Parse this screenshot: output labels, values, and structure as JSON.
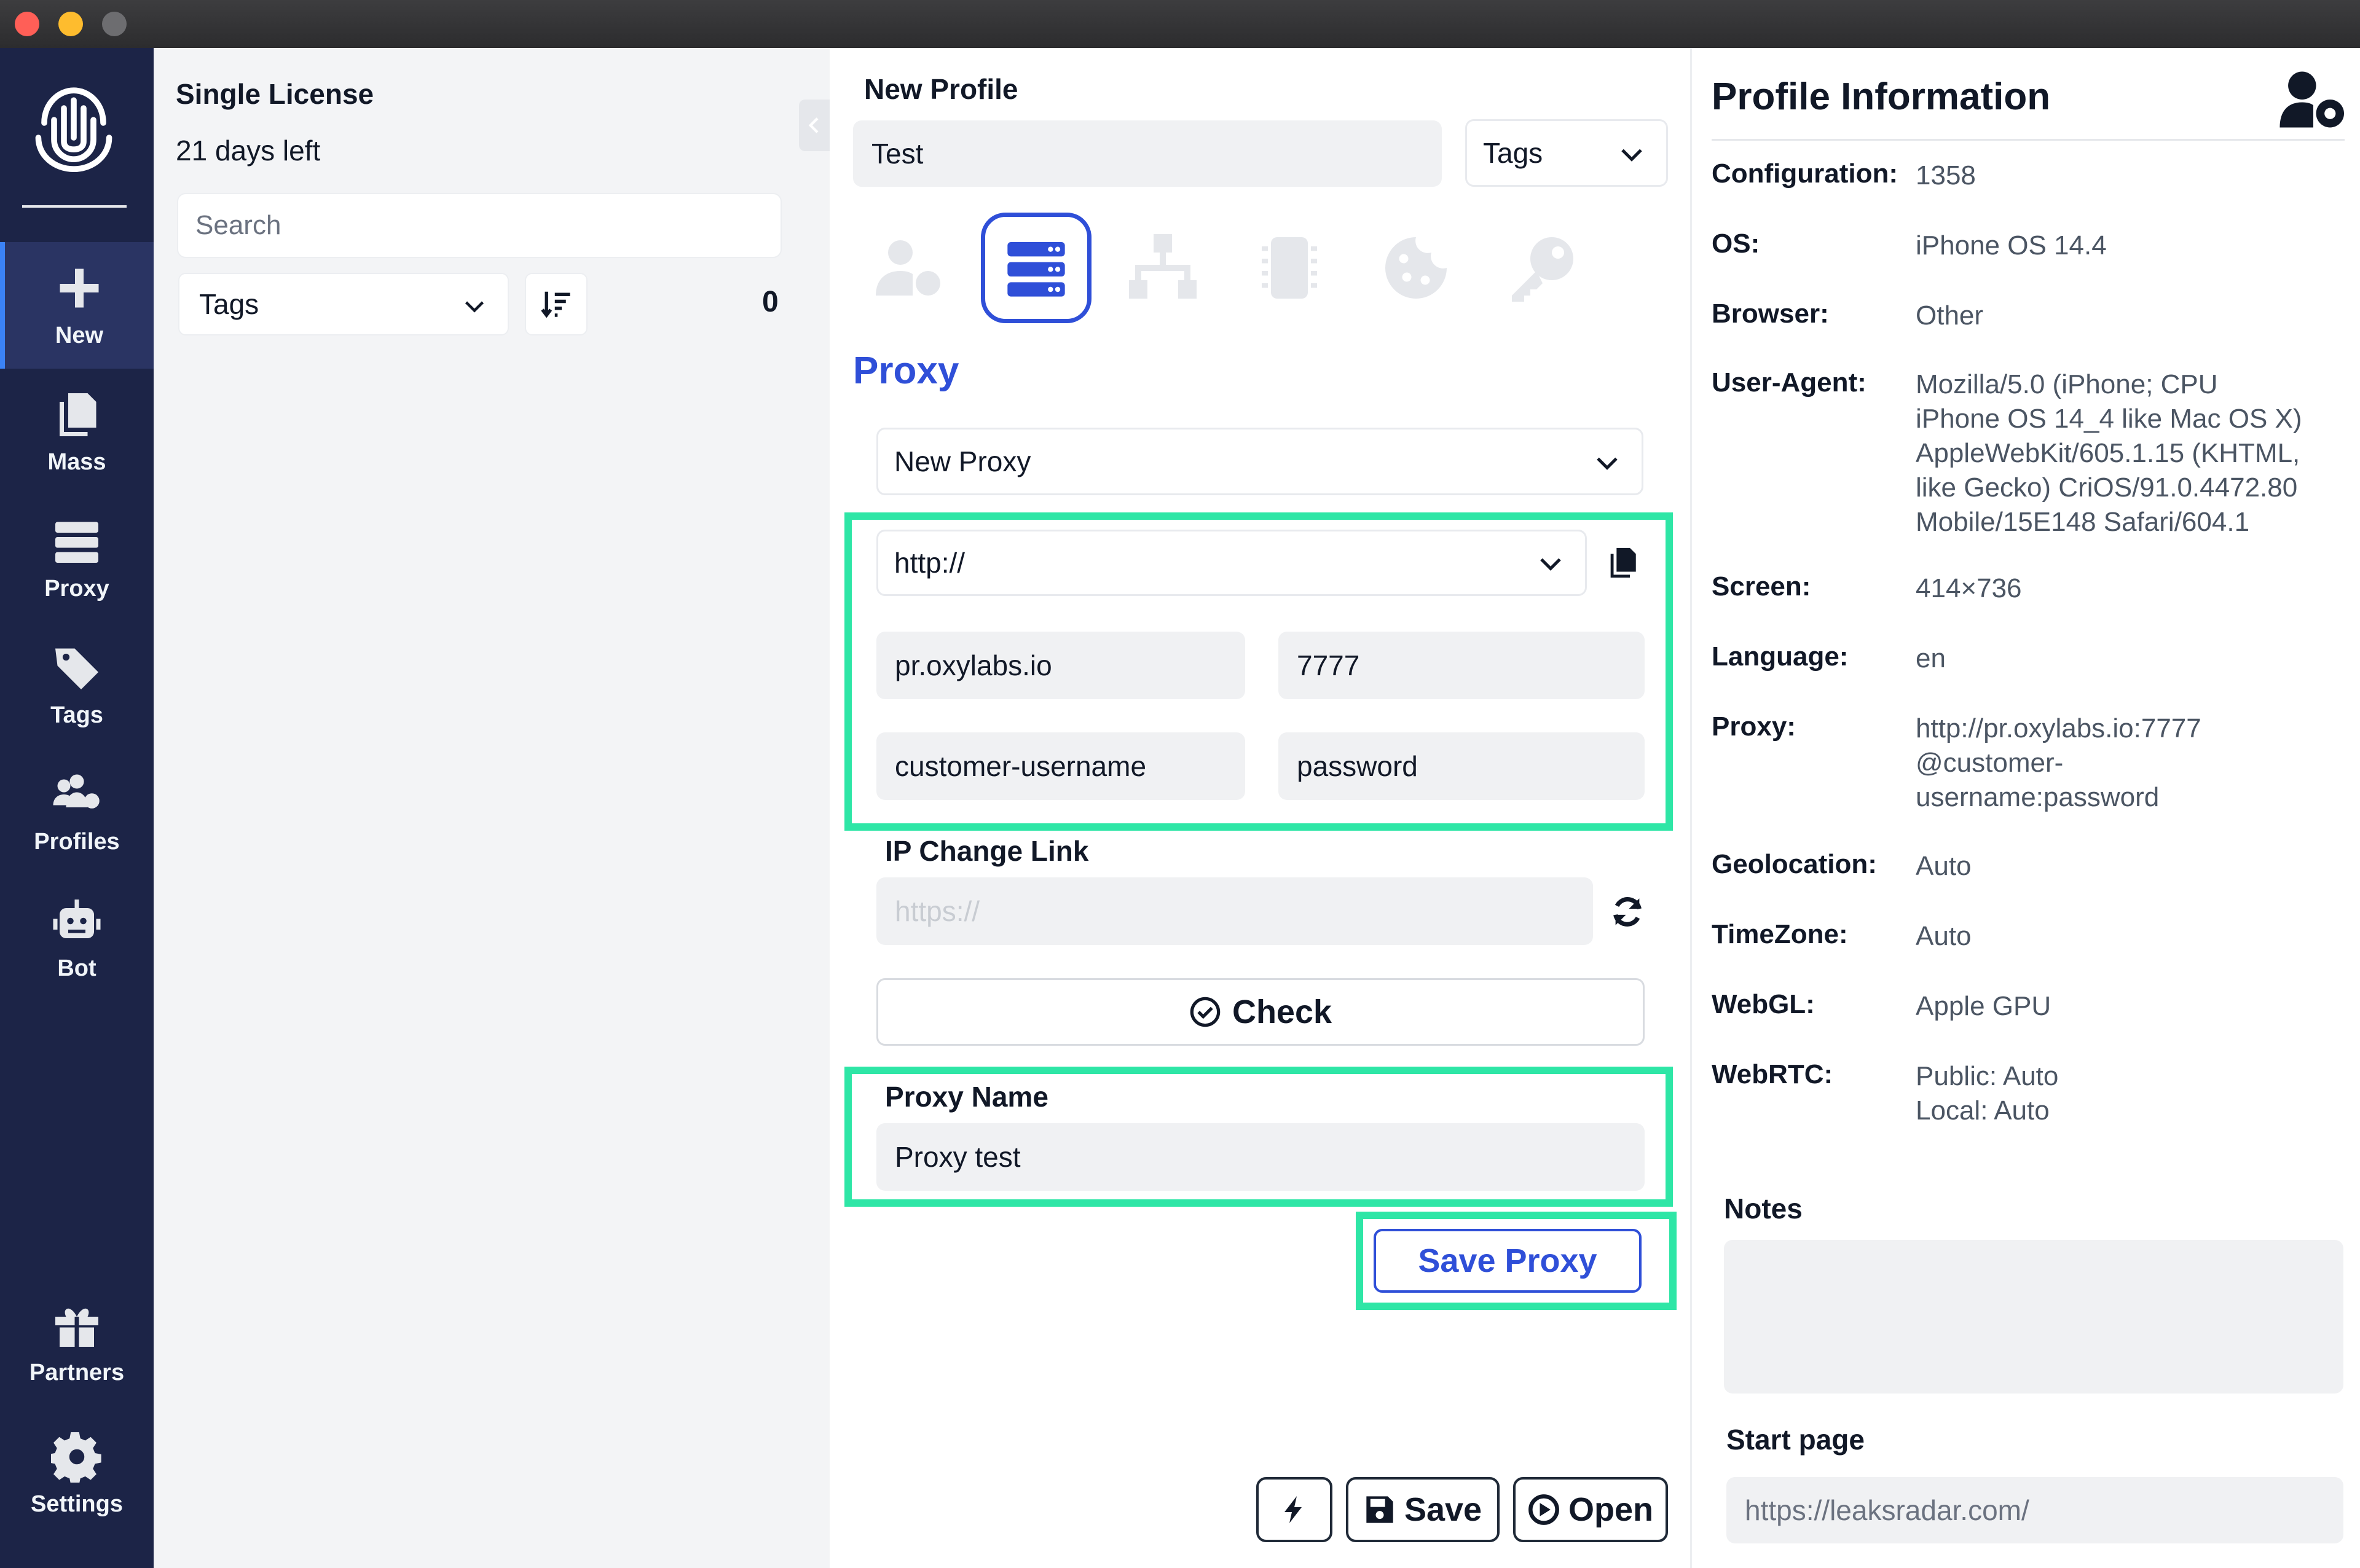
{
  "sidebar": {
    "items": [
      {
        "id": "new",
        "label": "New",
        "icon": "plus-icon",
        "active": true
      },
      {
        "id": "mass",
        "label": "Mass",
        "icon": "copy-icon"
      },
      {
        "id": "proxy",
        "label": "Proxy",
        "icon": "server-icon"
      },
      {
        "id": "tags",
        "label": "Tags",
        "icon": "tags-icon"
      },
      {
        "id": "profiles",
        "label": "Profiles",
        "icon": "users-gear-icon"
      },
      {
        "id": "bot",
        "label": "Bot",
        "icon": "robot-icon"
      },
      {
        "id": "partners",
        "label": "Partners",
        "icon": "gift-icon"
      },
      {
        "id": "settings",
        "label": "Settings",
        "icon": "gear-icon"
      }
    ]
  },
  "list": {
    "license_title": "Single License",
    "license_days": "21 days left",
    "search_placeholder": "Search",
    "tags_label": "Tags",
    "count": "0"
  },
  "editor": {
    "new_profile_label": "New Profile",
    "profile_name": "Test",
    "tags_label": "Tags",
    "section_title": "Proxy",
    "proxy_select": "New Proxy",
    "protocol": "http://",
    "host": "pr.oxylabs.io",
    "port": "7777",
    "username": "customer-username",
    "password": "password",
    "ip_change_label": "IP Change Link",
    "ip_change_placeholder": "https://",
    "check_label": "Check",
    "proxy_name_label": "Proxy Name",
    "proxy_name": "Proxy test",
    "save_proxy_label": "Save Proxy",
    "save_label": "Save",
    "open_label": "Open"
  },
  "info": {
    "title": "Profile Information",
    "rows": [
      {
        "key": "Configuration:",
        "value": "1358"
      },
      {
        "key": "OS:",
        "value": "iPhone OS 14.4"
      },
      {
        "key": "Browser:",
        "value": "Other"
      },
      {
        "key": "User-Agent:",
        "value": "Mozilla/5.0 (iPhone; CPU\niPhone OS 14_4 like Mac OS X)\nAppleWebKit/605.1.15 (KHTML,\nlike Gecko) CriOS/91.0.4472.80\nMobile/15E148 Safari/604.1"
      },
      {
        "key": "Screen:",
        "value": "414×736"
      },
      {
        "key": "Language:",
        "value": "en"
      },
      {
        "key": "Proxy:",
        "value": "http://pr.oxylabs.io:7777\n@customer-\nusername:password"
      },
      {
        "key": "Geolocation:",
        "value": "Auto"
      },
      {
        "key": "TimeZone:",
        "value": "Auto"
      },
      {
        "key": "WebGL:",
        "value": "Apple GPU"
      },
      {
        "key": "WebRTC:",
        "value": "Public: Auto\nLocal:  Auto"
      }
    ],
    "notes_label": "Notes",
    "start_page_label": "Start page",
    "start_page_value": "https://leaksradar.com/"
  },
  "colors": {
    "accent": "#2f4fd8",
    "highlight": "#2ee6a6",
    "rail": "#1c2447"
  }
}
